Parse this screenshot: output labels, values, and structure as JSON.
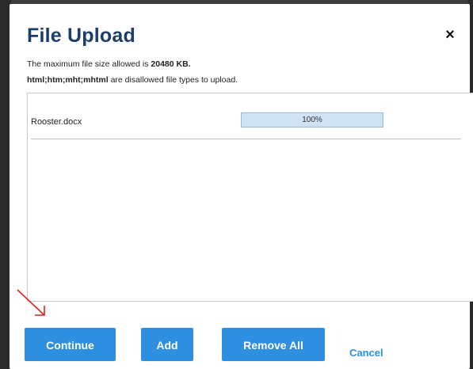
{
  "dialog": {
    "title": "File Upload",
    "close_label": "×",
    "info": {
      "max_size_prefix": "The maximum file size allowed is ",
      "max_size_value": "20480 KB.",
      "disallowed_types": "html;htm;mht;mhtml",
      "disallowed_suffix": " are disallowed file types to upload."
    },
    "files": [
      {
        "name": "Rooster.docx",
        "progress_text": "100%",
        "progress_value": 100
      }
    ],
    "buttons": {
      "continue": "Continue",
      "add": "Add",
      "remove_all": "Remove All",
      "cancel": "Cancel"
    }
  },
  "colors": {
    "title": "#1f3d6b",
    "button": "#2e8fe0",
    "annotation_arrow": "#e02020"
  }
}
